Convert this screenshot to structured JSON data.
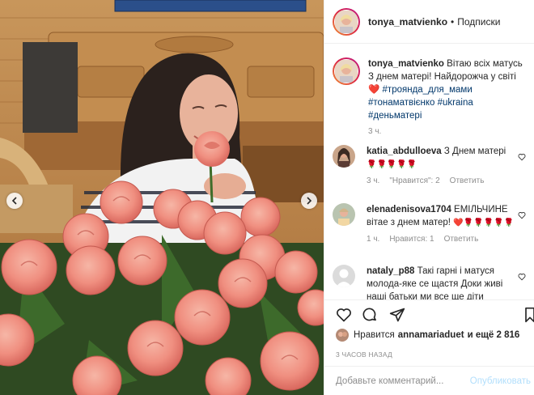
{
  "photo": {
    "alt_icon_prev": "chevron-left-icon",
    "alt_icon_next": "chevron-right-icon"
  },
  "header": {
    "username": "tonya_matvienko",
    "separator": "•",
    "follow_label": "Подписки"
  },
  "caption": {
    "username": "tonya_matvienko",
    "text": "Вітаю всіх матусь З днем матері! Найдорожча у світі",
    "emoji": "❤️",
    "hashtags": [
      "#троянда_для_мами",
      "#тонаматвієнко",
      "#ukraina",
      "#деньматері"
    ],
    "time": "3 ч."
  },
  "comments": [
    {
      "username": "katia_abdulloeva",
      "text": "З Днем матері",
      "emoji": "🌹🌹🌹🌹🌹",
      "time": "3 ч.",
      "likes": "\"Нравится\": 2",
      "reply": "Ответить"
    },
    {
      "username": "elenadenisova1704",
      "text": "ЕМІЛЬЧИНЕ вітае з днем матер!",
      "emoji": "❤️🌹🌹🌹🌹🌹",
      "time": "1 ч.",
      "likes": "Нравится: 1",
      "reply": "Ответить"
    },
    {
      "username": "nataly_p88",
      "text": "Такі гарні і матуся молода-яке се щастя Доки живі наші батьки ми все ще діти"
    }
  ],
  "likes": {
    "prefix": "Нравится",
    "user": "annamariaduet",
    "suffix": "и ещё 2 816"
  },
  "time_ago": "3 ЧАСОВ НАЗАД",
  "add_comment": {
    "placeholder": "Добавьте комментарий...",
    "publish_label": "Опубликовать"
  },
  "colors": {
    "link": "#00376b",
    "muted": "#8e8e8e",
    "publish": "#b2dffc",
    "heart_red": "#ed4956",
    "story_ring": "#dc2743"
  }
}
